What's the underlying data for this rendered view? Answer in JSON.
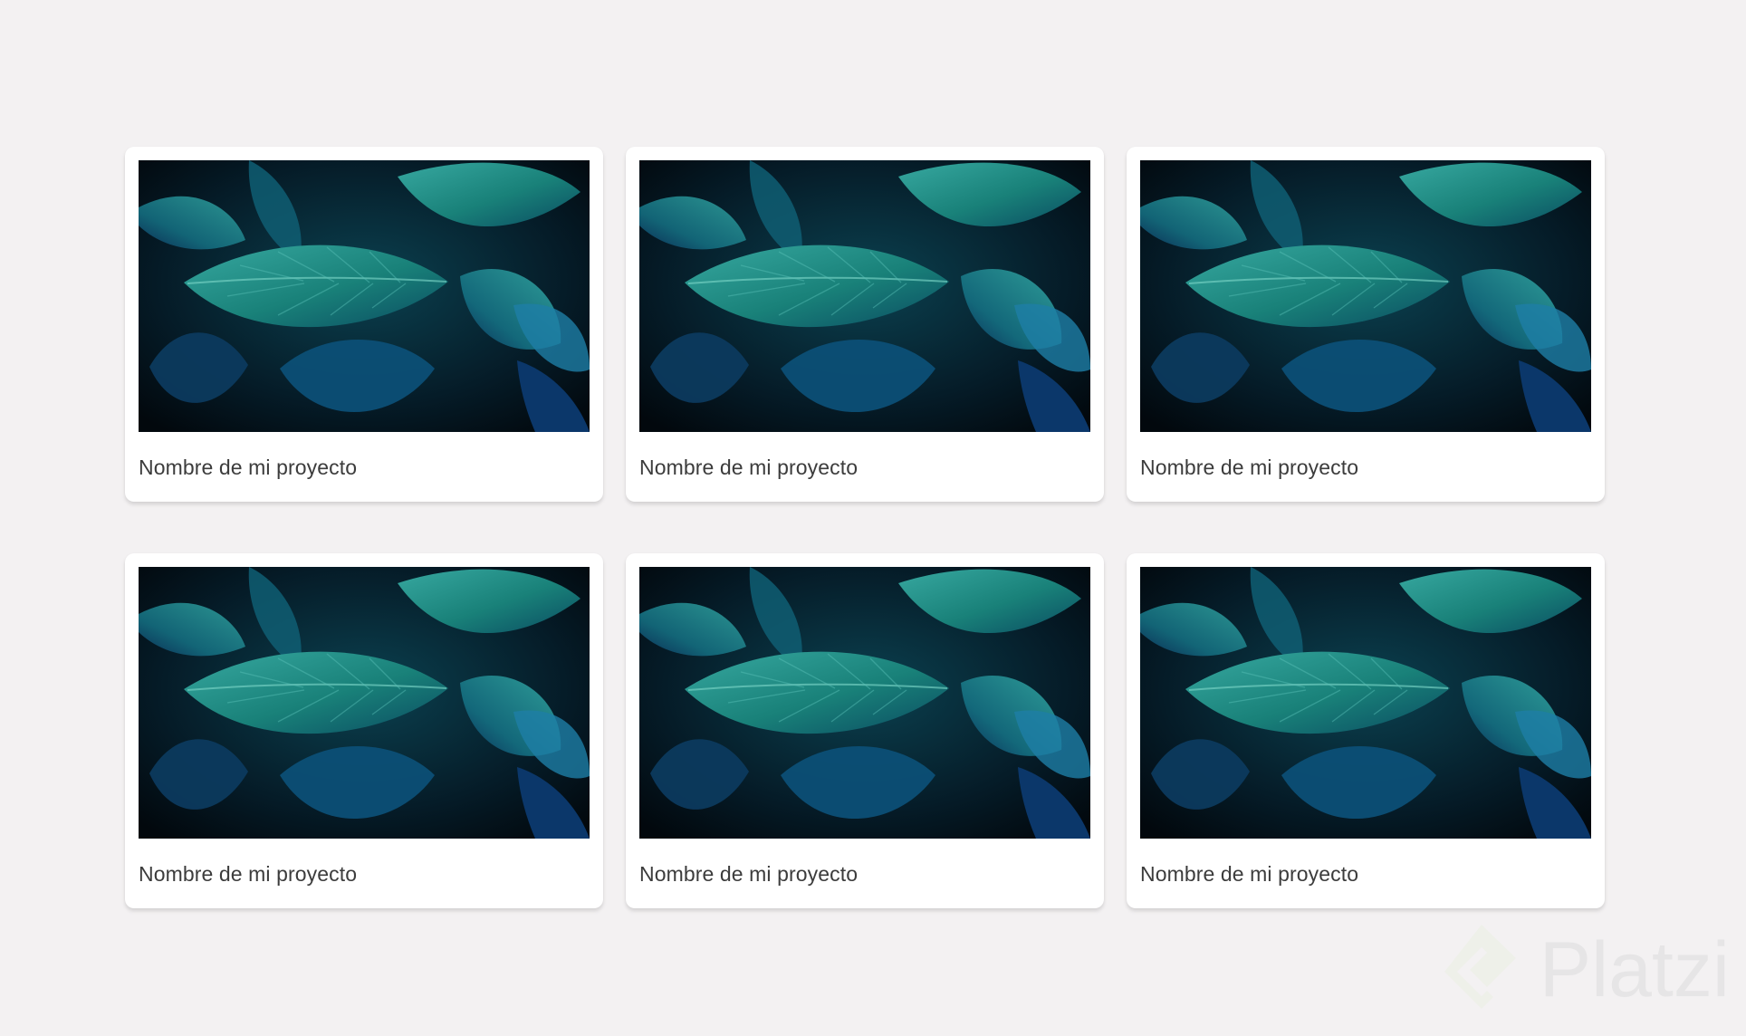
{
  "colors": {
    "background": "#f3f1f2",
    "card": "#ffffff",
    "card_title": "#3c3c3c",
    "leaf_teal": "#1f8f8a",
    "leaf_blue": "#11537d",
    "leaf_dark": "#03101a",
    "logo_mark": "#e9f0df",
    "logo_text": "#d6d6d6"
  },
  "projects": [
    {
      "title": "Nombre de mi proyecto",
      "image_icon": "leaf-image"
    },
    {
      "title": "Nombre de mi proyecto",
      "image_icon": "leaf-image"
    },
    {
      "title": "Nombre de mi proyecto",
      "image_icon": "leaf-image"
    },
    {
      "title": "Nombre de mi proyecto",
      "image_icon": "leaf-image"
    },
    {
      "title": "Nombre de mi proyecto",
      "image_icon": "leaf-image"
    },
    {
      "title": "Nombre de mi proyecto",
      "image_icon": "leaf-image"
    }
  ],
  "watermark": {
    "logo_text": "Platzi",
    "icon": "platzi-logo-icon"
  }
}
